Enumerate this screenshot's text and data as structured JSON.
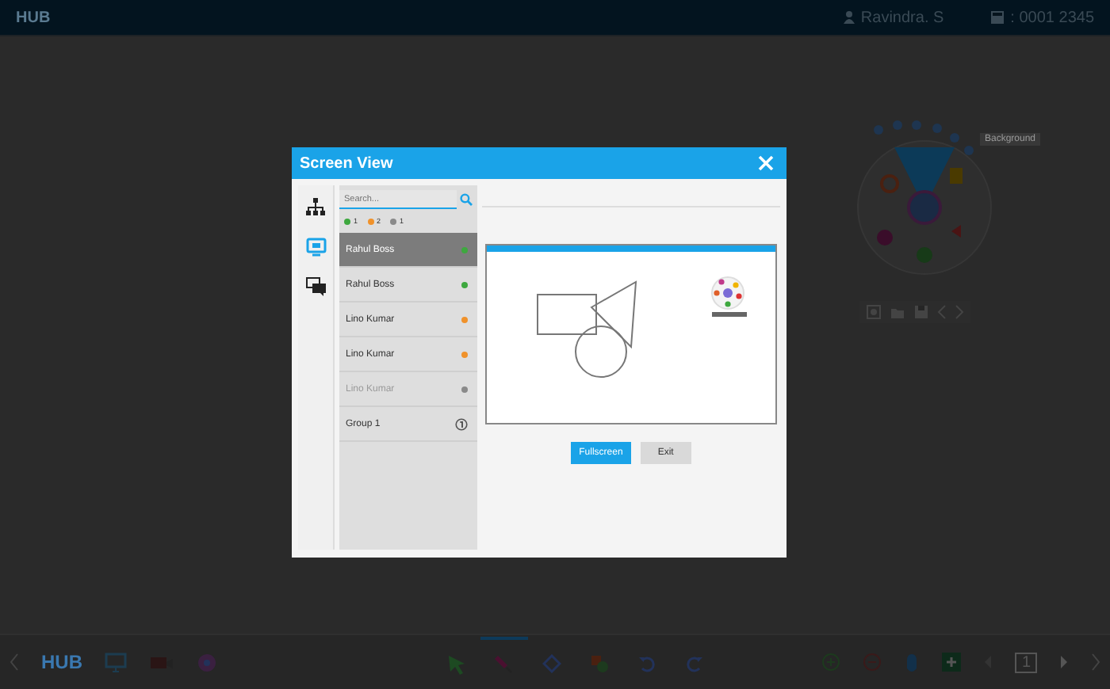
{
  "topbar": {
    "logo": "HUB",
    "user": "Ravindra. S",
    "code": ": 0001 2345"
  },
  "radial_menu": {
    "tooltip": "Background"
  },
  "dialog": {
    "title": "Screen View",
    "side_tabs": [
      {
        "kind": "groups",
        "selected": false
      },
      {
        "kind": "screen",
        "selected": true
      },
      {
        "kind": "chat",
        "selected": false
      }
    ],
    "search": {
      "placeholder": "Search..."
    },
    "status_counts": [
      {
        "count": "1",
        "color": "#3ea83f"
      },
      {
        "count": "2",
        "color": "#f0922b"
      },
      {
        "count": "1",
        "color": "#8a8a8a"
      }
    ],
    "users": [
      {
        "name": "Rahul Boss",
        "kind": "user",
        "selected": true,
        "disabled": false,
        "color": "#3ea83f"
      },
      {
        "name": "Rahul Boss",
        "kind": "user",
        "selected": false,
        "disabled": false,
        "color": "#3ea83f"
      },
      {
        "name": "Lino Kumar",
        "kind": "user",
        "selected": false,
        "disabled": false,
        "color": "#f0922b"
      },
      {
        "name": "Lino Kumar",
        "kind": "user",
        "selected": false,
        "disabled": false,
        "color": "#f0922b"
      },
      {
        "name": "Lino Kumar",
        "kind": "user",
        "selected": false,
        "disabled": true,
        "color": "#8a8a8a"
      },
      {
        "name": "Group 1",
        "kind": "group",
        "selected": false,
        "disabled": false,
        "color": "#555555"
      }
    ],
    "buttons": [
      {
        "label": "Fullscreen",
        "kind": "primary"
      },
      {
        "label": "Exit",
        "kind": "secondary"
      }
    ]
  },
  "bottom_toolbar": {
    "logo": "HUB",
    "tools": [
      {
        "kind": "cursor",
        "selected": false
      },
      {
        "kind": "pen",
        "selected": true
      },
      {
        "kind": "eraser",
        "selected": false
      },
      {
        "kind": "shapes",
        "selected": false
      },
      {
        "kind": "undo",
        "selected": false
      },
      {
        "kind": "redo",
        "selected": false
      }
    ],
    "page": "1"
  }
}
